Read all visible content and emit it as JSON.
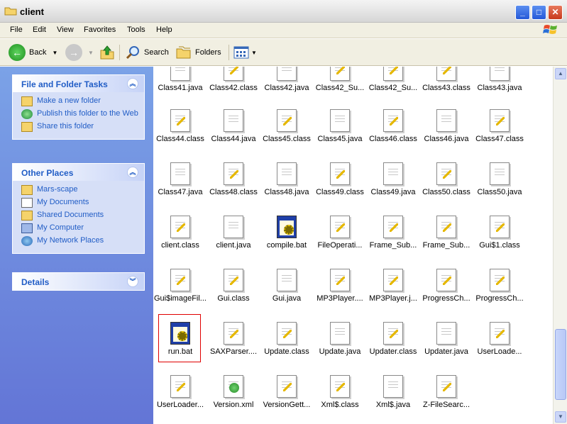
{
  "window": {
    "title": "client"
  },
  "menu": [
    "File",
    "Edit",
    "View",
    "Favorites",
    "Tools",
    "Help"
  ],
  "toolbar": {
    "back_label": "Back",
    "search_label": "Search",
    "folders_label": "Folders"
  },
  "panels": {
    "file_tasks": {
      "title": "File and Folder Tasks",
      "items": [
        "Make a new folder",
        "Publish this folder to the Web",
        "Share this folder"
      ]
    },
    "other_places": {
      "title": "Other Places",
      "items": [
        "Mars-scape",
        "My Documents",
        "Shared Documents",
        "My Computer",
        "My Network Places"
      ]
    },
    "details": {
      "title": "Details"
    }
  },
  "files": [
    [
      "Class41.java",
      "Class42.class",
      "Class42.java",
      "Class42_Su...",
      "Class42_Su...",
      "Class43.class",
      "Class43.java"
    ],
    [
      "Class44.class",
      "Class44.java",
      "Class45.class",
      "Class45.java",
      "Class46.class",
      "Class46.java",
      "Class47.class"
    ],
    [
      "Class47.java",
      "Class48.class",
      "Class48.java",
      "Class49.class",
      "Class49.java",
      "Class50.class",
      "Class50.java"
    ],
    [
      "client.class",
      "client.java",
      "compile.bat",
      "FileOperati...",
      "Frame_Sub...",
      "Frame_Sub...",
      "Gui$1.class"
    ],
    [
      "Gui$imageFil...",
      "Gui.class",
      "Gui.java",
      "MP3Player....",
      "MP3Player.j...",
      "ProgressCh...",
      "ProgressCh..."
    ],
    [
      "run.bat",
      "SAXParser....",
      "Update.class",
      "Update.java",
      "Updater.class",
      "Updater.java",
      "UserLoade..."
    ],
    [
      "UserLoader...",
      "Version.xml",
      "VersionGett...",
      "Xml$.class",
      "Xml$.java",
      "Z-FileSearc..."
    ]
  ]
}
